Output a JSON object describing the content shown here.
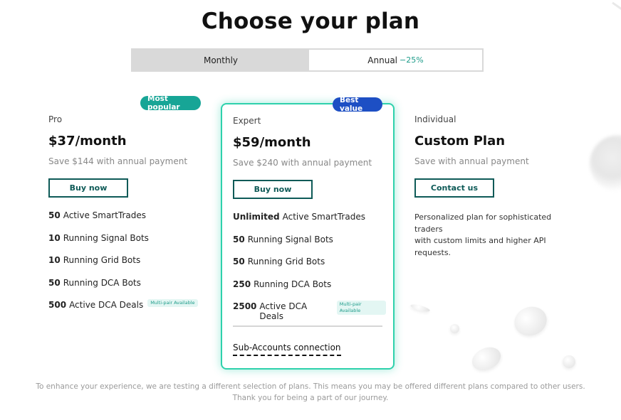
{
  "header": {
    "title": "Choose your plan"
  },
  "billing_toggle": {
    "monthly_label": "Monthly",
    "annual_label": "Annual",
    "annual_discount": "−25%"
  },
  "plans": [
    {
      "badge": "Most popular",
      "tier": "Pro",
      "price": "$37/month",
      "save_note": "Save $144 with annual payment",
      "button_label": "Buy now",
      "features": [
        {
          "count": "50",
          "text": "Active SmartTrades",
          "tag": ""
        },
        {
          "count": "10",
          "text": "Running Signal Bots",
          "tag": ""
        },
        {
          "count": "10",
          "text": "Running Grid Bots",
          "tag": ""
        },
        {
          "count": "50",
          "text": "Running DCA Bots",
          "tag": ""
        },
        {
          "count": "500",
          "text": "Active DCA Deals",
          "tag": "Multi-pair Available"
        }
      ]
    },
    {
      "badge": "Best value",
      "tier": "Expert",
      "price": "$59/month",
      "save_note": "Save $240 with annual payment",
      "button_label": "Buy now",
      "features": [
        {
          "count": "Unlimited",
          "text": "Active SmartTrades",
          "tag": ""
        },
        {
          "count": "50",
          "text": "Running Signal Bots",
          "tag": ""
        },
        {
          "count": "50",
          "text": "Running Grid Bots",
          "tag": ""
        },
        {
          "count": "250",
          "text": "Running DCA Bots",
          "tag": ""
        },
        {
          "count": "2500",
          "text": "Active DCA Deals",
          "tag": "Multi-pair Available"
        }
      ],
      "extra_link": "Sub-Accounts connection"
    },
    {
      "tier": "Individual",
      "price": "Custom Plan",
      "save_note": "Save with annual payment",
      "button_label": "Contact us",
      "description_line1": "Personalized plan for sophisticated traders",
      "description_line2": "with custom limits and higher API requests."
    }
  ],
  "footer": {
    "line1": "To enhance your experience, we are testing a different selection of plans. This means you may be offered different plans compared to other users.",
    "line2": "Thank you for being a part of our journey."
  },
  "colors": {
    "accent_teal": "#17a596",
    "accent_blue": "#1d4fc4",
    "button_border": "#0e5a57",
    "card_glow": "#2ed1ac"
  }
}
